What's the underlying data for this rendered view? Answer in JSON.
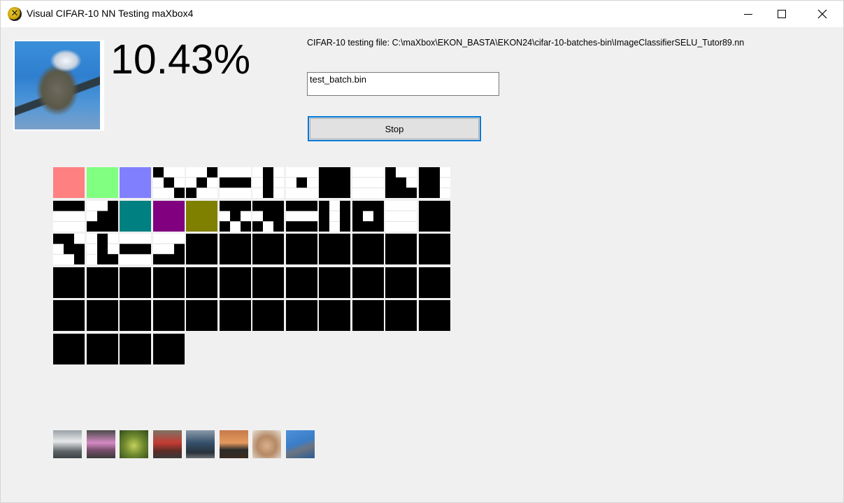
{
  "window": {
    "title": "Visual CIFAR-10 NN Testing maXbox4",
    "controls": [
      "minimize",
      "maximize",
      "close"
    ]
  },
  "main": {
    "accuracy": "10.43%",
    "file_label": "CIFAR-10 testing file: C:\\maXbox\\EKON_BASTA\\EKON24\\cifar-10-batches-bin\\ImageClassifierSELU_Tutor89.nn",
    "file_input_value": "test_batch.bin",
    "stop_label": "Stop"
  },
  "icons": {
    "app": "maxbox-x-icon",
    "preview": "bird-image",
    "minimize": "minimize-icon",
    "maximize": "maximize-icon",
    "close": "close-icon"
  },
  "colors": {
    "button_focus": "#0078d7",
    "filter_red": "#ff8080",
    "filter_green": "#80ff80",
    "filter_blue": "#8080ff",
    "filter_teal": "#008080",
    "filter_purple": "#800080",
    "filter_olive": "#808000"
  },
  "filters": {
    "columns": 12,
    "count": 64,
    "first_row": [
      "red",
      "green",
      "blue",
      "pattern",
      "pattern",
      "pattern",
      "pattern",
      "pattern",
      "pattern",
      "pattern",
      "pattern",
      "pattern"
    ],
    "second_row": [
      "pattern",
      "pattern",
      "teal",
      "purple",
      "olive",
      "pattern",
      "pattern",
      "pattern",
      "pattern",
      "pattern",
      "pattern",
      "pattern"
    ]
  },
  "thumbnails": [
    "truck",
    "car",
    "frog",
    "car",
    "truck",
    "landscape",
    "dog",
    "bird"
  ]
}
